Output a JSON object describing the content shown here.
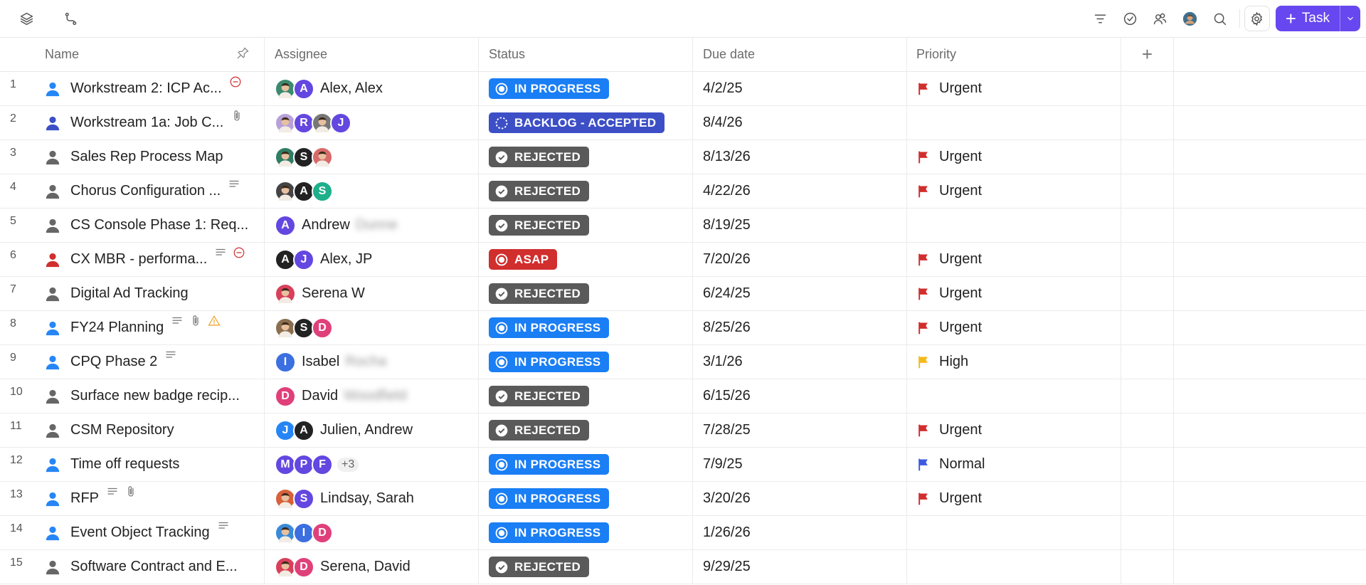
{
  "toolbar": {
    "left_icons": [
      "layers-icon",
      "route-icon"
    ],
    "right_icons": [
      "filter-icon",
      "check-circle-icon",
      "users-icon",
      "user-avatar",
      "search-icon"
    ],
    "task_button_label": "Task"
  },
  "columns": {
    "name": "Name",
    "assignee": "Assignee",
    "status": "Status",
    "due_date": "Due date",
    "priority": "Priority",
    "add": "+"
  },
  "colors": {
    "in_progress": "#1a7ef5",
    "backlog_accepted": "#3d4fc6",
    "rejected": "#5a5a5a",
    "asap": "#d12e2e",
    "urgent_flag": "#d12e2e",
    "high_flag": "#f5b81c",
    "normal_flag": "#3c5be0",
    "accent": "#6647f0"
  },
  "rows": [
    {
      "num": "1",
      "name": "Workstream 2: ICP Ac...",
      "person_color": "#2686f5",
      "icons": [
        "minus-circle-icon"
      ],
      "avatars": [
        {
          "type": "photo",
          "color": "#3b8a6e"
        },
        {
          "letter": "A",
          "color": "#6347e0"
        }
      ],
      "assignee": "Alex, Alex",
      "blur": "",
      "status": "IN PROGRESS",
      "status_kind": "in_progress",
      "due": "4/2/25",
      "priority": "Urgent",
      "priority_kind": "urgent"
    },
    {
      "num": "2",
      "name": "Workstream 1a: Job C...",
      "person_color": "#3d4fc6",
      "icons": [
        "paperclip-icon"
      ],
      "avatars": [
        {
          "type": "photo",
          "color": "#b8a1d8"
        },
        {
          "letter": "R",
          "color": "#6347e0"
        },
        {
          "type": "photo",
          "color": "#777777"
        },
        {
          "letter": "J",
          "color": "#6347e0"
        }
      ],
      "assignee": "",
      "blur": "",
      "status": "BACKLOG - ACCEPTED",
      "status_kind": "backlog_accepted",
      "due": "8/4/26",
      "priority": "",
      "priority_kind": ""
    },
    {
      "num": "3",
      "name": "Sales Rep Process Map",
      "person_color": "#666666",
      "icons": [],
      "avatars": [
        {
          "type": "photo",
          "color": "#2f7d63"
        },
        {
          "letter": "S",
          "color": "#222222"
        },
        {
          "type": "photo",
          "color": "#d86a6a"
        }
      ],
      "assignee": "",
      "blur": "",
      "status": "REJECTED",
      "status_kind": "rejected",
      "due": "8/13/26",
      "priority": "Urgent",
      "priority_kind": "urgent"
    },
    {
      "num": "4",
      "name": "Chorus Configuration ...",
      "person_color": "#666666",
      "icons": [
        "description-icon"
      ],
      "avatars": [
        {
          "type": "photo",
          "color": "#444444"
        },
        {
          "letter": "A",
          "color": "#222222"
        },
        {
          "letter": "S",
          "color": "#1eb08a"
        }
      ],
      "assignee": "",
      "blur": "",
      "status": "REJECTED",
      "status_kind": "rejected",
      "due": "4/22/26",
      "priority": "Urgent",
      "priority_kind": "urgent"
    },
    {
      "num": "5",
      "name": "CS Console Phase 1: Req...",
      "person_color": "#666666",
      "icons": [],
      "avatars": [
        {
          "letter": "A",
          "color": "#6347e0"
        }
      ],
      "assignee": "Andrew",
      "blur": "Dunne",
      "status": "REJECTED",
      "status_kind": "rejected",
      "due": "8/19/25",
      "priority": "",
      "priority_kind": ""
    },
    {
      "num": "6",
      "name": "CX MBR - performa...",
      "person_color": "#d12e2e",
      "icons": [
        "description-icon",
        "minus-circle-icon"
      ],
      "avatars": [
        {
          "letter": "A",
          "color": "#222222"
        },
        {
          "letter": "J",
          "color": "#6347e0"
        }
      ],
      "assignee": "Alex, JP",
      "blur": "",
      "status": "ASAP",
      "status_kind": "asap",
      "due": "7/20/26",
      "priority": "Urgent",
      "priority_kind": "urgent"
    },
    {
      "num": "7",
      "name": "Digital Ad Tracking",
      "person_color": "#666666",
      "icons": [],
      "avatars": [
        {
          "type": "photo",
          "color": "#d8405a"
        }
      ],
      "assignee": "Serena W",
      "blur": "",
      "status": "REJECTED",
      "status_kind": "rejected",
      "due": "6/24/25",
      "priority": "Urgent",
      "priority_kind": "urgent"
    },
    {
      "num": "8",
      "name": "FY24 Planning",
      "person_color": "#2686f5",
      "icons": [
        "description-icon",
        "paperclip-icon",
        "warning-icon"
      ],
      "avatars": [
        {
          "type": "photo",
          "color": "#8a6e4e"
        },
        {
          "letter": "S",
          "color": "#222222"
        },
        {
          "letter": "D",
          "color": "#e0407a"
        }
      ],
      "assignee": "",
      "blur": "",
      "status": "IN PROGRESS",
      "status_kind": "in_progress",
      "due": "8/25/26",
      "priority": "Urgent",
      "priority_kind": "urgent"
    },
    {
      "num": "9",
      "name": "CPQ Phase 2",
      "person_color": "#2686f5",
      "icons": [
        "description-icon"
      ],
      "avatars": [
        {
          "letter": "I",
          "color": "#3c6fe0"
        }
      ],
      "assignee": "Isabel",
      "blur": "Rocha",
      "status": "IN PROGRESS",
      "status_kind": "in_progress",
      "due": "3/1/26",
      "priority": "High",
      "priority_kind": "high"
    },
    {
      "num": "10",
      "name": "Surface new badge recip...",
      "person_color": "#666666",
      "icons": [],
      "avatars": [
        {
          "letter": "D",
          "color": "#e0407a"
        }
      ],
      "assignee": "David",
      "blur": "Woodfield",
      "status": "REJECTED",
      "status_kind": "rejected",
      "due": "6/15/26",
      "priority": "",
      "priority_kind": ""
    },
    {
      "num": "11",
      "name": "CSM Repository",
      "person_color": "#666666",
      "icons": [],
      "avatars": [
        {
          "letter": "J",
          "color": "#2686f5"
        },
        {
          "letter": "A",
          "color": "#222222"
        }
      ],
      "assignee": "Julien, Andrew",
      "blur": "",
      "status": "REJECTED",
      "status_kind": "rejected",
      "due": "7/28/25",
      "priority": "Urgent",
      "priority_kind": "urgent"
    },
    {
      "num": "12",
      "name": "Time off requests",
      "person_color": "#2686f5",
      "icons": [],
      "avatars": [
        {
          "letter": "M",
          "color": "#6347e0"
        },
        {
          "letter": "P",
          "color": "#6347e0"
        },
        {
          "letter": "F",
          "color": "#6347e0"
        }
      ],
      "more": "+3",
      "assignee": "",
      "blur": "",
      "status": "IN PROGRESS",
      "status_kind": "in_progress",
      "due": "7/9/25",
      "priority": "Normal",
      "priority_kind": "normal"
    },
    {
      "num": "13",
      "name": "RFP",
      "person_color": "#2686f5",
      "icons": [
        "description-icon",
        "paperclip-icon"
      ],
      "avatars": [
        {
          "type": "photo",
          "color": "#d8603a"
        },
        {
          "letter": "S",
          "color": "#6347e0"
        }
      ],
      "assignee": "Lindsay, Sarah",
      "blur": "",
      "status": "IN PROGRESS",
      "status_kind": "in_progress",
      "due": "3/20/26",
      "priority": "Urgent",
      "priority_kind": "urgent"
    },
    {
      "num": "14",
      "name": "Event Object Tracking",
      "person_color": "#2686f5",
      "icons": [
        "description-icon"
      ],
      "avatars": [
        {
          "type": "photo",
          "color": "#3a8ad8"
        },
        {
          "letter": "I",
          "color": "#3c6fe0"
        },
        {
          "letter": "D",
          "color": "#e0407a"
        }
      ],
      "assignee": "",
      "blur": "",
      "status": "IN PROGRESS",
      "status_kind": "in_progress",
      "due": "1/26/26",
      "priority": "",
      "priority_kind": ""
    },
    {
      "num": "15",
      "name": "Software Contract and E...",
      "person_color": "#666666",
      "icons": [],
      "avatars": [
        {
          "type": "photo",
          "color": "#d8405a"
        },
        {
          "letter": "D",
          "color": "#e0407a"
        }
      ],
      "assignee": "Serena, David",
      "blur": "",
      "status": "REJECTED",
      "status_kind": "rejected",
      "due": "9/29/25",
      "priority": "",
      "priority_kind": ""
    }
  ]
}
